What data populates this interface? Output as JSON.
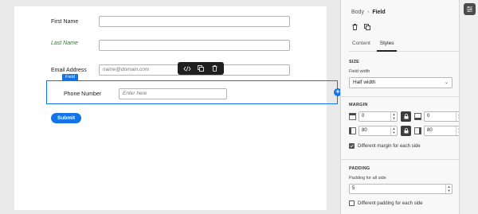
{
  "form": {
    "fields": [
      {
        "label": "First Name",
        "placeholder": ""
      },
      {
        "label": "Last Name",
        "placeholder": ""
      },
      {
        "label": "Email Address",
        "placeholder": "name@domain.com"
      },
      {
        "label": "Phone Number",
        "placeholder": "Enter here"
      }
    ],
    "selected_tag": "Field",
    "submit_label": "Submit",
    "add_symbol": "+"
  },
  "toolbar": {
    "icons": [
      "code-icon",
      "copy-icon",
      "trash-icon"
    ]
  },
  "panel": {
    "breadcrumb": {
      "parent": "Body",
      "current": "Field"
    },
    "actions": [
      "trash-icon",
      "copy-icon"
    ],
    "tabs": [
      {
        "label": "Content"
      },
      {
        "label": "Styles"
      }
    ],
    "active_tab": "Styles",
    "size": {
      "title": "SIZE",
      "field_width_label": "Field width",
      "field_width_value": "Half width"
    },
    "margin": {
      "title": "MARGIN",
      "top": "0",
      "bottom": "0",
      "left": "80",
      "right": "80",
      "different_label": "Different margin for each side",
      "different_checked": true
    },
    "padding": {
      "title": "PADDING",
      "all_label": "Padding for all side",
      "all_value": "5",
      "different_label": "Different padding for each side",
      "different_checked": false
    }
  },
  "colors": {
    "accent": "#1473e6",
    "toolbar": "#1f1f1f",
    "italic_label": "#2d7a2d"
  }
}
